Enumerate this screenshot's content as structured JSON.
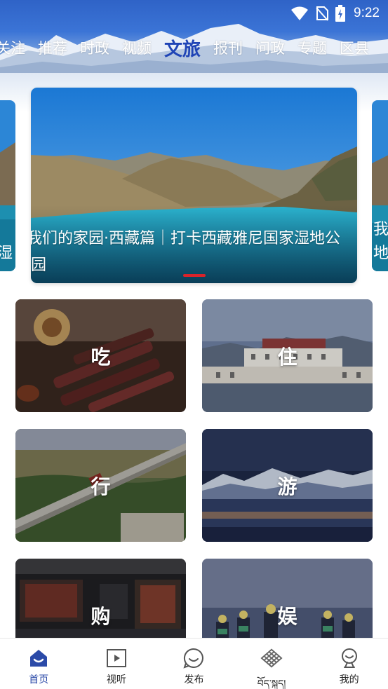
{
  "status_bar": {
    "time": "9:22"
  },
  "channel_tabs": [
    {
      "label": "关注",
      "active": false
    },
    {
      "label": "推荐",
      "active": false
    },
    {
      "label": "时政",
      "active": false
    },
    {
      "label": "视频",
      "active": false
    },
    {
      "label": "文旅",
      "active": true
    },
    {
      "label": "报刊",
      "active": false
    },
    {
      "label": "问政",
      "active": false
    },
    {
      "label": "专题",
      "active": false
    },
    {
      "label": "区县",
      "active": false
    }
  ],
  "banner": {
    "caption": "我们的家园·西藏篇｜打卡西藏雅尼国家湿地公园",
    "prev_caption": "湿\n",
    "next_caption": "我们\n地公"
  },
  "categories": [
    {
      "label": "吃"
    },
    {
      "label": "住"
    },
    {
      "label": "行"
    },
    {
      "label": "游"
    },
    {
      "label": "购"
    },
    {
      "label": "娱"
    }
  ],
  "bottom_nav": [
    {
      "label": "首页",
      "icon": "home-icon",
      "active": true
    },
    {
      "label": "视听",
      "icon": "video-play-icon",
      "active": false
    },
    {
      "label": "发布",
      "icon": "smile-chat-icon",
      "active": false
    },
    {
      "label": "བོད་སྐད།",
      "icon": "endless-knot-icon",
      "active": false
    },
    {
      "label": "我的",
      "icon": "profile-icon",
      "active": false
    }
  ],
  "colors": {
    "accent": "#1f44b6",
    "nav_active": "#2b4aa8",
    "indicator": "#d8232a"
  }
}
